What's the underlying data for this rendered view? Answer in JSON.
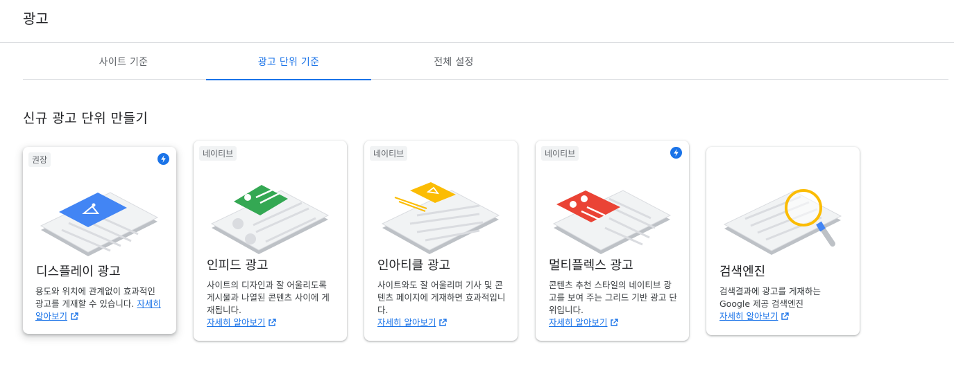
{
  "header": {
    "title": "광고"
  },
  "tabs": [
    {
      "label": "사이트 기준"
    },
    {
      "label": "광고 단위 기준"
    },
    {
      "label": "전체 설정"
    }
  ],
  "section": {
    "title": "신규 광고 단위 만들기"
  },
  "cards": [
    {
      "badge": "권장",
      "title": "디스플레이 광고",
      "desc": "용도와 위치에 관계없이 효과적인 광고를 게재할 수 있습니다. ",
      "link": "자세히 알아보기",
      "accent": "#4285f4"
    },
    {
      "badge": "네이티브",
      "title": "인피드 광고",
      "desc": "사이트의 디자인과 잘 어울리도록 게시물과 나열된 콘텐츠 사이에 게재됩니다.",
      "link": "자세히 알아보기",
      "accent": "#34a853"
    },
    {
      "badge": "네이티브",
      "title": "인아티클 광고",
      "desc": "사이트와도 잘 어울리며 기사 및 콘텐츠 페이지에 게재하면 효과적입니다.",
      "link": "자세히 알아보기",
      "accent": "#fbbc04"
    },
    {
      "badge": "네이티브",
      "title": "멀티플렉스 광고",
      "desc": "콘텐츠 추천 스타일의 네이티브 광고를 보여 주는 그리드 기반 광고 단위입니다.",
      "link": "자세히 알아보기",
      "accent": "#ea4335"
    },
    {
      "title": "검색엔진",
      "desc": "검색결과에 광고를 게재하는 Google 제공 검색엔진",
      "link": "자세히 알아보기",
      "accent": "#fbbc04"
    }
  ],
  "icons": {
    "bolt": "bolt-icon",
    "external": "open-in-new-icon"
  },
  "colors": {
    "primary": "#1a73e8",
    "text": "#202124",
    "muted": "#5f6368"
  }
}
